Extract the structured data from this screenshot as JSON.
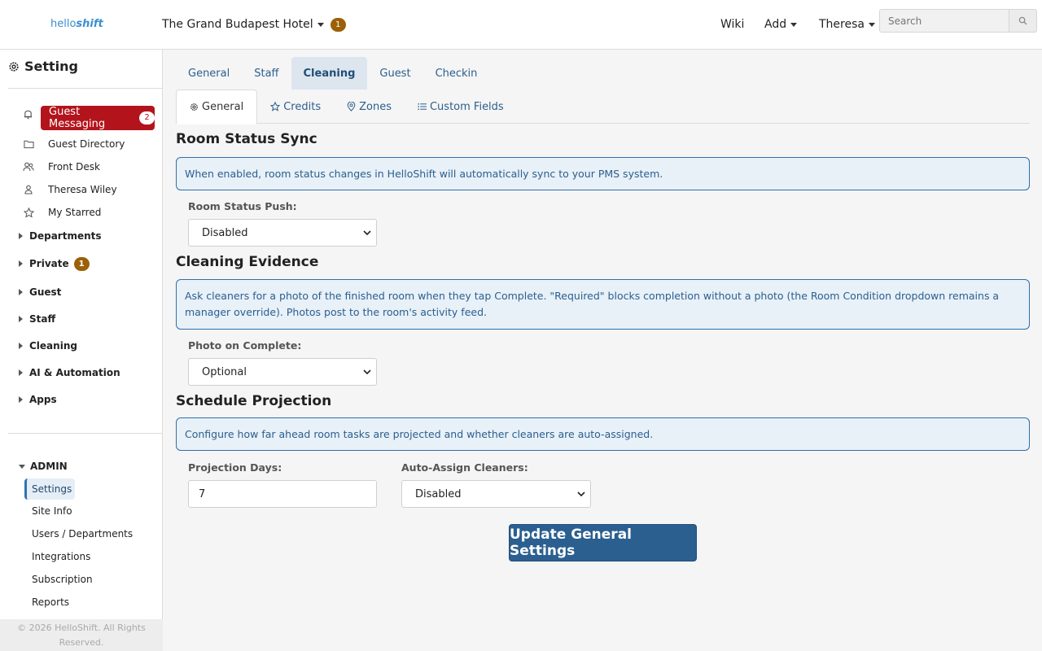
{
  "header": {
    "logo": {
      "hello": "hello",
      "shift": "shift"
    },
    "hotel_name": "The Grand Budapest Hotel",
    "hotel_badge": "1",
    "nav": {
      "wiki": "Wiki",
      "add": "Add",
      "user": "Theresa"
    },
    "search": {
      "placeholder": "Search",
      "icon": "search-icon"
    }
  },
  "sidebar": {
    "title": "Setting",
    "guest_messaging": {
      "label": "Guest Messaging",
      "count": "2"
    },
    "items": [
      {
        "label": "Guest Directory",
        "icon": "folder-icon"
      },
      {
        "label": "Front Desk",
        "icon": "users-icon"
      },
      {
        "label": "Theresa Wiley",
        "icon": "person-icon"
      },
      {
        "label": "My Starred",
        "icon": "star-icon"
      }
    ],
    "sections": [
      {
        "label": "Departments"
      },
      {
        "label": "Private",
        "badge": "1"
      },
      {
        "label": "Guest"
      },
      {
        "label": "Staff"
      },
      {
        "label": "Cleaning"
      },
      {
        "label": "AI & Automation"
      },
      {
        "label": "Apps"
      }
    ],
    "admin": {
      "label": "ADMIN",
      "items": [
        "Settings",
        "Site Info",
        "Users / Departments",
        "Integrations",
        "Subscription",
        "Reports"
      ]
    },
    "footer": "© 2026 HelloShift. All Rights Reserved."
  },
  "main": {
    "top_tabs": [
      "General",
      "Staff",
      "Cleaning",
      "Guest",
      "Checkin"
    ],
    "active_top_tab": "Cleaning",
    "sub_tabs": [
      "General",
      "Credits",
      "Zones",
      "Custom Fields"
    ],
    "active_sub_tab": "General",
    "room_status": {
      "title": "Room Status Sync",
      "info": "When enabled, room status changes in HelloShift will automatically sync to your PMS system.",
      "label": "Room Status Push:",
      "value": "Disabled"
    },
    "cleaning_evidence": {
      "title": "Cleaning Evidence",
      "info": "Ask cleaners for a photo of the finished room when they tap Complete. \"Required\" blocks completion without a photo (the Room Condition dropdown remains a manager override). Photos post to the room's activity feed.",
      "label": "Photo on Complete:",
      "value": "Optional"
    },
    "schedule": {
      "title": "Schedule Projection",
      "info": "Configure how far ahead room tasks are projected and whether cleaners are auto-assigned.",
      "days_label": "Projection Days:",
      "days_value": "7",
      "auto_label": "Auto-Assign Cleaners:",
      "auto_value": "Disabled"
    },
    "submit": "Update General Settings"
  },
  "colors": {
    "accent": "#2b5f8f",
    "danger": "#b3141c",
    "badge": "#9c6008",
    "info_bg": "#e8f0f8"
  }
}
